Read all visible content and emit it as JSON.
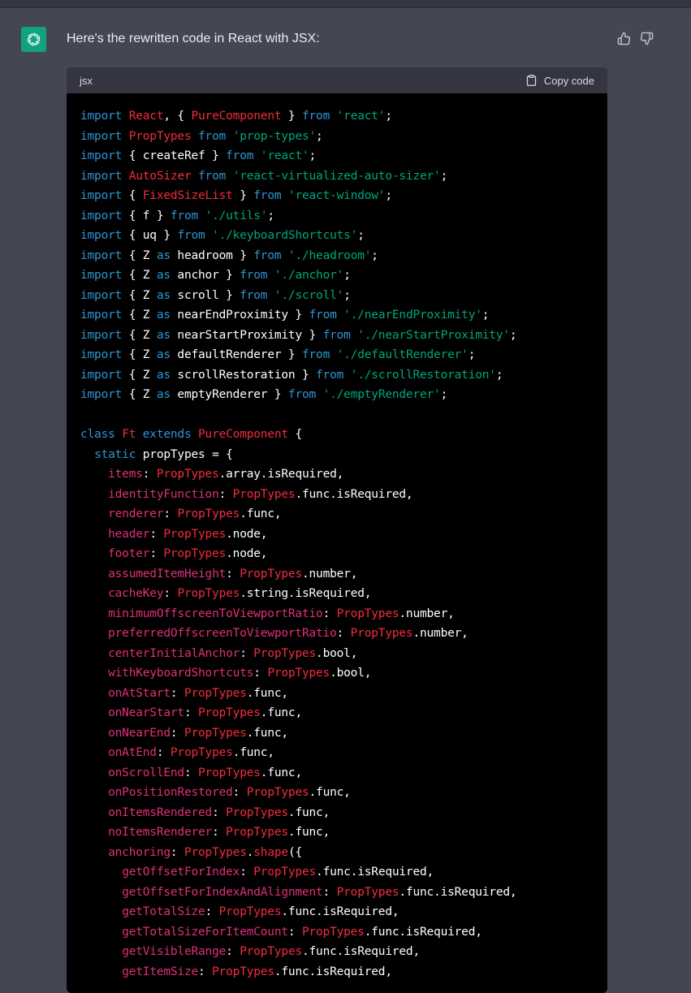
{
  "message": {
    "intro": "Here's the rewritten code in React with JSX:",
    "feedback": {
      "up_icon": "thumbs-up-icon",
      "down_icon": "thumbs-down-icon"
    }
  },
  "code_block": {
    "language": "jsx",
    "copy_label": "Copy code",
    "lines": [
      [
        [
          "kw",
          "import"
        ],
        [
          "pl",
          " "
        ],
        [
          "cls",
          "React"
        ],
        [
          "pl",
          ", { "
        ],
        [
          "cls",
          "PureComponent"
        ],
        [
          "pl",
          " } "
        ],
        [
          "kw",
          "from"
        ],
        [
          "pl",
          " "
        ],
        [
          "str",
          "'react'"
        ],
        [
          "pl",
          ";"
        ]
      ],
      [
        [
          "kw",
          "import"
        ],
        [
          "pl",
          " "
        ],
        [
          "cls",
          "PropTypes"
        ],
        [
          "pl",
          " "
        ],
        [
          "kw",
          "from"
        ],
        [
          "pl",
          " "
        ],
        [
          "str",
          "'prop-types'"
        ],
        [
          "pl",
          ";"
        ]
      ],
      [
        [
          "kw",
          "import"
        ],
        [
          "pl",
          " { createRef } "
        ],
        [
          "kw",
          "from"
        ],
        [
          "pl",
          " "
        ],
        [
          "str",
          "'react'"
        ],
        [
          "pl",
          ";"
        ]
      ],
      [
        [
          "kw",
          "import"
        ],
        [
          "pl",
          " "
        ],
        [
          "cls",
          "AutoSizer"
        ],
        [
          "pl",
          " "
        ],
        [
          "kw",
          "from"
        ],
        [
          "pl",
          " "
        ],
        [
          "str",
          "'react-virtualized-auto-sizer'"
        ],
        [
          "pl",
          ";"
        ]
      ],
      [
        [
          "kw",
          "import"
        ],
        [
          "pl",
          " { "
        ],
        [
          "cls",
          "FixedSizeList"
        ],
        [
          "pl",
          " } "
        ],
        [
          "kw",
          "from"
        ],
        [
          "pl",
          " "
        ],
        [
          "str",
          "'react-window'"
        ],
        [
          "pl",
          ";"
        ]
      ],
      [
        [
          "kw",
          "import"
        ],
        [
          "pl",
          " { f } "
        ],
        [
          "kw",
          "from"
        ],
        [
          "pl",
          " "
        ],
        [
          "str",
          "'./utils'"
        ],
        [
          "pl",
          ";"
        ]
      ],
      [
        [
          "kw",
          "import"
        ],
        [
          "pl",
          " { uq } "
        ],
        [
          "kw",
          "from"
        ],
        [
          "pl",
          " "
        ],
        [
          "str",
          "'./keyboardShortcuts'"
        ],
        [
          "pl",
          ";"
        ]
      ],
      [
        [
          "kw",
          "import"
        ],
        [
          "pl",
          " { Z "
        ],
        [
          "kw",
          "as"
        ],
        [
          "pl",
          " headroom } "
        ],
        [
          "kw",
          "from"
        ],
        [
          "pl",
          " "
        ],
        [
          "str",
          "'./headroom'"
        ],
        [
          "pl",
          ";"
        ]
      ],
      [
        [
          "kw",
          "import"
        ],
        [
          "pl",
          " { Z "
        ],
        [
          "kw",
          "as"
        ],
        [
          "pl",
          " anchor } "
        ],
        [
          "kw",
          "from"
        ],
        [
          "pl",
          " "
        ],
        [
          "str",
          "'./anchor'"
        ],
        [
          "pl",
          ";"
        ]
      ],
      [
        [
          "kw",
          "import"
        ],
        [
          "pl",
          " { Z "
        ],
        [
          "kw",
          "as"
        ],
        [
          "pl",
          " scroll } "
        ],
        [
          "kw",
          "from"
        ],
        [
          "pl",
          " "
        ],
        [
          "str",
          "'./scroll'"
        ],
        [
          "pl",
          ";"
        ]
      ],
      [
        [
          "kw",
          "import"
        ],
        [
          "pl",
          " { Z "
        ],
        [
          "kw",
          "as"
        ],
        [
          "pl",
          " nearEndProximity } "
        ],
        [
          "kw",
          "from"
        ],
        [
          "pl",
          " "
        ],
        [
          "str",
          "'./nearEndProximity'"
        ],
        [
          "pl",
          ";"
        ]
      ],
      [
        [
          "kw",
          "import"
        ],
        [
          "pl",
          " { Z "
        ],
        [
          "kw",
          "as"
        ],
        [
          "pl",
          " nearStartProximity } "
        ],
        [
          "kw",
          "from"
        ],
        [
          "pl",
          " "
        ],
        [
          "str",
          "'./nearStartProximity'"
        ],
        [
          "pl",
          ";"
        ]
      ],
      [
        [
          "kw",
          "import"
        ],
        [
          "pl",
          " { Z "
        ],
        [
          "kw",
          "as"
        ],
        [
          "pl",
          " defaultRenderer } "
        ],
        [
          "kw",
          "from"
        ],
        [
          "pl",
          " "
        ],
        [
          "str",
          "'./defaultRenderer'"
        ],
        [
          "pl",
          ";"
        ]
      ],
      [
        [
          "kw",
          "import"
        ],
        [
          "pl",
          " { Z "
        ],
        [
          "kw",
          "as"
        ],
        [
          "pl",
          " scrollRestoration } "
        ],
        [
          "kw",
          "from"
        ],
        [
          "pl",
          " "
        ],
        [
          "str",
          "'./scrollRestoration'"
        ],
        [
          "pl",
          ";"
        ]
      ],
      [
        [
          "kw",
          "import"
        ],
        [
          "pl",
          " { Z "
        ],
        [
          "kw",
          "as"
        ],
        [
          "pl",
          " emptyRenderer } "
        ],
        [
          "kw",
          "from"
        ],
        [
          "pl",
          " "
        ],
        [
          "str",
          "'./emptyRenderer'"
        ],
        [
          "pl",
          ";"
        ]
      ],
      [],
      [
        [
          "kw",
          "class"
        ],
        [
          "pl",
          " "
        ],
        [
          "cls",
          "Ft"
        ],
        [
          "pl",
          " "
        ],
        [
          "kw",
          "extends"
        ],
        [
          "pl",
          " "
        ],
        [
          "cls",
          "PureComponent"
        ],
        [
          "pl",
          " {"
        ]
      ],
      [
        [
          "pl",
          "  "
        ],
        [
          "kw",
          "static"
        ],
        [
          "pl",
          " propTypes = {"
        ]
      ],
      [
        [
          "pl",
          "    "
        ],
        [
          "prop",
          "items"
        ],
        [
          "pl",
          ": "
        ],
        [
          "cls",
          "PropTypes"
        ],
        [
          "pl",
          ".array.isRequired,"
        ]
      ],
      [
        [
          "pl",
          "    "
        ],
        [
          "prop",
          "identityFunction"
        ],
        [
          "pl",
          ": "
        ],
        [
          "cls",
          "PropTypes"
        ],
        [
          "pl",
          ".func.isRequired,"
        ]
      ],
      [
        [
          "pl",
          "    "
        ],
        [
          "prop",
          "renderer"
        ],
        [
          "pl",
          ": "
        ],
        [
          "cls",
          "PropTypes"
        ],
        [
          "pl",
          ".func,"
        ]
      ],
      [
        [
          "pl",
          "    "
        ],
        [
          "prop",
          "header"
        ],
        [
          "pl",
          ": "
        ],
        [
          "cls",
          "PropTypes"
        ],
        [
          "pl",
          ".node,"
        ]
      ],
      [
        [
          "pl",
          "    "
        ],
        [
          "prop",
          "footer"
        ],
        [
          "pl",
          ": "
        ],
        [
          "cls",
          "PropTypes"
        ],
        [
          "pl",
          ".node,"
        ]
      ],
      [
        [
          "pl",
          "    "
        ],
        [
          "prop",
          "assumedItemHeight"
        ],
        [
          "pl",
          ": "
        ],
        [
          "cls",
          "PropTypes"
        ],
        [
          "pl",
          ".number,"
        ]
      ],
      [
        [
          "pl",
          "    "
        ],
        [
          "prop",
          "cacheKey"
        ],
        [
          "pl",
          ": "
        ],
        [
          "cls",
          "PropTypes"
        ],
        [
          "pl",
          ".string.isRequired,"
        ]
      ],
      [
        [
          "pl",
          "    "
        ],
        [
          "prop",
          "minimumOffscreenToViewportRatio"
        ],
        [
          "pl",
          ": "
        ],
        [
          "cls",
          "PropTypes"
        ],
        [
          "pl",
          ".number,"
        ]
      ],
      [
        [
          "pl",
          "    "
        ],
        [
          "prop",
          "preferredOffscreenToViewportRatio"
        ],
        [
          "pl",
          ": "
        ],
        [
          "cls",
          "PropTypes"
        ],
        [
          "pl",
          ".number,"
        ]
      ],
      [
        [
          "pl",
          "    "
        ],
        [
          "prop",
          "centerInitialAnchor"
        ],
        [
          "pl",
          ": "
        ],
        [
          "cls",
          "PropTypes"
        ],
        [
          "pl",
          ".bool,"
        ]
      ],
      [
        [
          "pl",
          "    "
        ],
        [
          "prop",
          "withKeyboardShortcuts"
        ],
        [
          "pl",
          ": "
        ],
        [
          "cls",
          "PropTypes"
        ],
        [
          "pl",
          ".bool,"
        ]
      ],
      [
        [
          "pl",
          "    "
        ],
        [
          "prop",
          "onAtStart"
        ],
        [
          "pl",
          ": "
        ],
        [
          "cls",
          "PropTypes"
        ],
        [
          "pl",
          ".func,"
        ]
      ],
      [
        [
          "pl",
          "    "
        ],
        [
          "prop",
          "onNearStart"
        ],
        [
          "pl",
          ": "
        ],
        [
          "cls",
          "PropTypes"
        ],
        [
          "pl",
          ".func,"
        ]
      ],
      [
        [
          "pl",
          "    "
        ],
        [
          "prop",
          "onNearEnd"
        ],
        [
          "pl",
          ": "
        ],
        [
          "cls",
          "PropTypes"
        ],
        [
          "pl",
          ".func,"
        ]
      ],
      [
        [
          "pl",
          "    "
        ],
        [
          "prop",
          "onAtEnd"
        ],
        [
          "pl",
          ": "
        ],
        [
          "cls",
          "PropTypes"
        ],
        [
          "pl",
          ".func,"
        ]
      ],
      [
        [
          "pl",
          "    "
        ],
        [
          "prop",
          "onScrollEnd"
        ],
        [
          "pl",
          ": "
        ],
        [
          "cls",
          "PropTypes"
        ],
        [
          "pl",
          ".func,"
        ]
      ],
      [
        [
          "pl",
          "    "
        ],
        [
          "prop",
          "onPositionRestored"
        ],
        [
          "pl",
          ": "
        ],
        [
          "cls",
          "PropTypes"
        ],
        [
          "pl",
          ".func,"
        ]
      ],
      [
        [
          "pl",
          "    "
        ],
        [
          "prop",
          "onItemsRendered"
        ],
        [
          "pl",
          ": "
        ],
        [
          "cls",
          "PropTypes"
        ],
        [
          "pl",
          ".func,"
        ]
      ],
      [
        [
          "pl",
          "    "
        ],
        [
          "prop",
          "noItemsRenderer"
        ],
        [
          "pl",
          ": "
        ],
        [
          "cls",
          "PropTypes"
        ],
        [
          "pl",
          ".func,"
        ]
      ],
      [
        [
          "pl",
          "    "
        ],
        [
          "prop",
          "anchoring"
        ],
        [
          "pl",
          ": "
        ],
        [
          "cls",
          "PropTypes"
        ],
        [
          "pl",
          "."
        ],
        [
          "cls",
          "shape"
        ],
        [
          "pl",
          "({"
        ]
      ],
      [
        [
          "pl",
          "      "
        ],
        [
          "prop",
          "getOffsetForIndex"
        ],
        [
          "pl",
          ": "
        ],
        [
          "cls",
          "PropTypes"
        ],
        [
          "pl",
          ".func.isRequired,"
        ]
      ],
      [
        [
          "pl",
          "      "
        ],
        [
          "prop",
          "getOffsetForIndexAndAlignment"
        ],
        [
          "pl",
          ": "
        ],
        [
          "cls",
          "PropTypes"
        ],
        [
          "pl",
          ".func.isRequired,"
        ]
      ],
      [
        [
          "pl",
          "      "
        ],
        [
          "prop",
          "getTotalSize"
        ],
        [
          "pl",
          ": "
        ],
        [
          "cls",
          "PropTypes"
        ],
        [
          "pl",
          ".func.isRequired,"
        ]
      ],
      [
        [
          "pl",
          "      "
        ],
        [
          "prop",
          "getTotalSizeForItemCount"
        ],
        [
          "pl",
          ": "
        ],
        [
          "cls",
          "PropTypes"
        ],
        [
          "pl",
          ".func.isRequired,"
        ]
      ],
      [
        [
          "pl",
          "      "
        ],
        [
          "prop",
          "getVisibleRange"
        ],
        [
          "pl",
          ": "
        ],
        [
          "cls",
          "PropTypes"
        ],
        [
          "pl",
          ".func.isRequired,"
        ]
      ],
      [
        [
          "pl",
          "      "
        ],
        [
          "prop",
          "getItemSize"
        ],
        [
          "pl",
          ": "
        ],
        [
          "cls",
          "PropTypes"
        ],
        [
          "pl",
          ".func.isRequired,"
        ]
      ]
    ]
  }
}
